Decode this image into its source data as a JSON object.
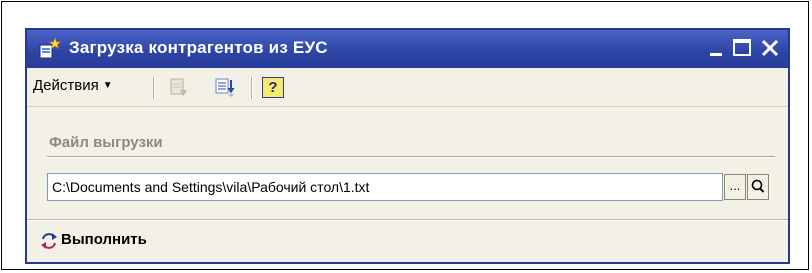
{
  "window": {
    "title": "Загрузка контрагентов из ЕУС"
  },
  "toolbar": {
    "actions_label": "Действия",
    "help_label": "?"
  },
  "file_group": {
    "label": "Файл выгрузки",
    "path_value": "C:\\Documents and Settings\\vila\\Рабочий стол\\1.txt",
    "browse_label": "..."
  },
  "footer": {
    "execute_label": "Выполнить"
  },
  "colors": {
    "titlebar": "#2d44a5",
    "window_bg": "#f3f1e6",
    "help_bg": "#f7e96a"
  },
  "icons": {
    "title": "form-star-icon",
    "toolbar_1": "undo-page-icon",
    "toolbar_2": "load-arrow-icon",
    "browse": "ellipsis-icon",
    "search": "magnifier-icon",
    "execute": "refresh-run-icon"
  }
}
